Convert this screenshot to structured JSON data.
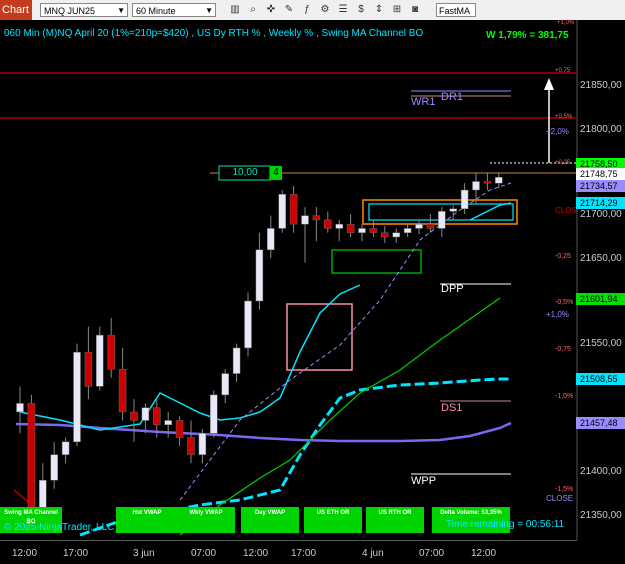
{
  "toolbar": {
    "title": "Chart",
    "instrument": "MNQ JUN25",
    "interval": "60 Minute",
    "indicator": "FastMA"
  },
  "header": {
    "info": "060 Min  (M)NQ April 20 (1%=210p=$420) , US Dy RTH % , Weekly % , Swing MA Channel BO",
    "weekly_stat": "W 1,79% = 381,75"
  },
  "order_box": {
    "qty": "10,00",
    "count": "4"
  },
  "levels": [
    "DR1",
    "WR1",
    "DPP",
    "DS1",
    "WPP"
  ],
  "pct_labels": [
    "+1,0%",
    "+0,75",
    "+0,5%",
    "+2,0%",
    "+0,25",
    "-0,25",
    "-0,5%",
    "+1,0%",
    "-0,75",
    "-1,0%",
    "-1,5%",
    "CLOS",
    "CLOSE"
  ],
  "price_axis": [
    "21850,00",
    "21800,00",
    "21750,00",
    "21700,00",
    "21650,00",
    "21600,00",
    "21550,00",
    "21500,00",
    "21450,00",
    "21400,00",
    "21350,00"
  ],
  "price_labels": [
    {
      "value": "21758,50",
      "color": "#00ff00"
    },
    {
      "value": "21748,75",
      "color": "#ffffff"
    },
    {
      "value": "21734,57",
      "color": "#9a8cff"
    },
    {
      "value": "21714,29",
      "color": "#00e5ff"
    },
    {
      "value": "21601,94",
      "color": "#00e000"
    },
    {
      "value": "21508,55",
      "color": "#00e5ff"
    },
    {
      "value": "21457,48",
      "color": "#9a8cff"
    }
  ],
  "time_axis": [
    "12:00",
    "17:00",
    "3 jun",
    "07:00",
    "12:00",
    "17:00",
    "4 jun",
    "07:00",
    "12:00"
  ],
  "bottom_buttons": [
    "Swing MA Channel BO",
    "Hst VWAP",
    "Wkly VWAP",
    "Day VWAP",
    "US ETH OR",
    "US RTH OR",
    "Delta Volume: 53,35%"
  ],
  "footer": {
    "copyright": "© 2025 NinjaTrader, LLC",
    "time_remaining": "Time remaining = 00:56:11"
  },
  "colors": {
    "up_candle": "#e8e8f8",
    "down_candle": "#cc0000",
    "fast_ma": "#00e5ff",
    "slow_ma": "#7b68ee",
    "green_ma": "#00cc00",
    "button_green": "#00d400"
  },
  "chart_data": {
    "type": "candlestick",
    "candles": [
      [
        21480,
        21510,
        21455,
        21490
      ],
      [
        21490,
        21500,
        21340,
        21360
      ],
      [
        21360,
        21420,
        21340,
        21400
      ],
      [
        21400,
        21445,
        21390,
        21430
      ],
      [
        21430,
        21450,
        21420,
        21445
      ],
      [
        21445,
        21560,
        21440,
        21550
      ],
      [
        21550,
        21580,
        21495,
        21510
      ],
      [
        21510,
        21580,
        21505,
        21570
      ],
      [
        21570,
        21590,
        21520,
        21530
      ],
      [
        21530,
        21555,
        21470,
        21480
      ],
      [
        21480,
        21495,
        21445,
        21470
      ],
      [
        21470,
        21490,
        21455,
        21485
      ],
      [
        21485,
        21495,
        21450,
        21465
      ],
      [
        21465,
        21480,
        21450,
        21470
      ],
      [
        21470,
        21475,
        21440,
        21450
      ],
      [
        21450,
        21470,
        21420,
        21430
      ],
      [
        21430,
        21460,
        21420,
        21455
      ],
      [
        21455,
        21505,
        21450,
        21500
      ],
      [
        21500,
        21530,
        21490,
        21525
      ],
      [
        21525,
        21560,
        21515,
        21555
      ],
      [
        21555,
        21620,
        21545,
        21610
      ],
      [
        21610,
        21690,
        21600,
        21670
      ],
      [
        21670,
        21710,
        21660,
        21695
      ],
      [
        21695,
        21740,
        21690,
        21735
      ],
      [
        21735,
        21745,
        21690,
        21700
      ],
      [
        21700,
        21720,
        21655,
        21710
      ],
      [
        21710,
        21720,
        21680,
        21705
      ],
      [
        21705,
        21715,
        21690,
        21695
      ],
      [
        21695,
        21705,
        21680,
        21700
      ],
      [
        21700,
        21712,
        21685,
        21690
      ],
      [
        21690,
        21700,
        21680,
        21695
      ],
      [
        21695,
        21705,
        21685,
        21690
      ],
      [
        21690,
        21698,
        21678,
        21685
      ],
      [
        21685,
        21695,
        21678,
        21690
      ],
      [
        21690,
        21700,
        21685,
        21695
      ],
      [
        21695,
        21705,
        21688,
        21700
      ],
      [
        21700,
        21712,
        21690,
        21695
      ],
      [
        21695,
        21720,
        21685,
        21715
      ],
      [
        21715,
        21722,
        21705,
        21718
      ],
      [
        21718,
        21748,
        21712,
        21740
      ],
      [
        21740,
        21760,
        21725,
        21750
      ],
      [
        21750,
        21760,
        21740,
        21748
      ],
      [
        21748,
        21760,
        21742,
        21755
      ]
    ],
    "series": [
      {
        "name": "FastMA",
        "values": [
          21380,
          21400,
          21440,
          21450,
          21470,
          21480,
          21485,
          21490,
          21495,
          21505,
          21540,
          21590,
          21620,
          21640,
          21650,
          21675,
          21690,
          21700,
          21705,
          21712,
          21714
        ]
      },
      {
        "name": "SlowMA",
        "values": [
          21475,
          21478,
          21480,
          21478,
          21473,
          21468,
          21464,
          21460,
          21458,
          21457,
          21457,
          21458,
          21460,
          21462,
          21464,
          21466,
          21470
        ]
      },
      {
        "name": "GreenMA",
        "values": [
          21360,
          21370,
          21380,
          21385,
          21395,
          21410,
          21430,
          21460,
          21490,
          21520,
          21545,
          21570,
          21590,
          21602
        ]
      }
    ],
    "ylim": [
      21330,
      21890
    ]
  }
}
